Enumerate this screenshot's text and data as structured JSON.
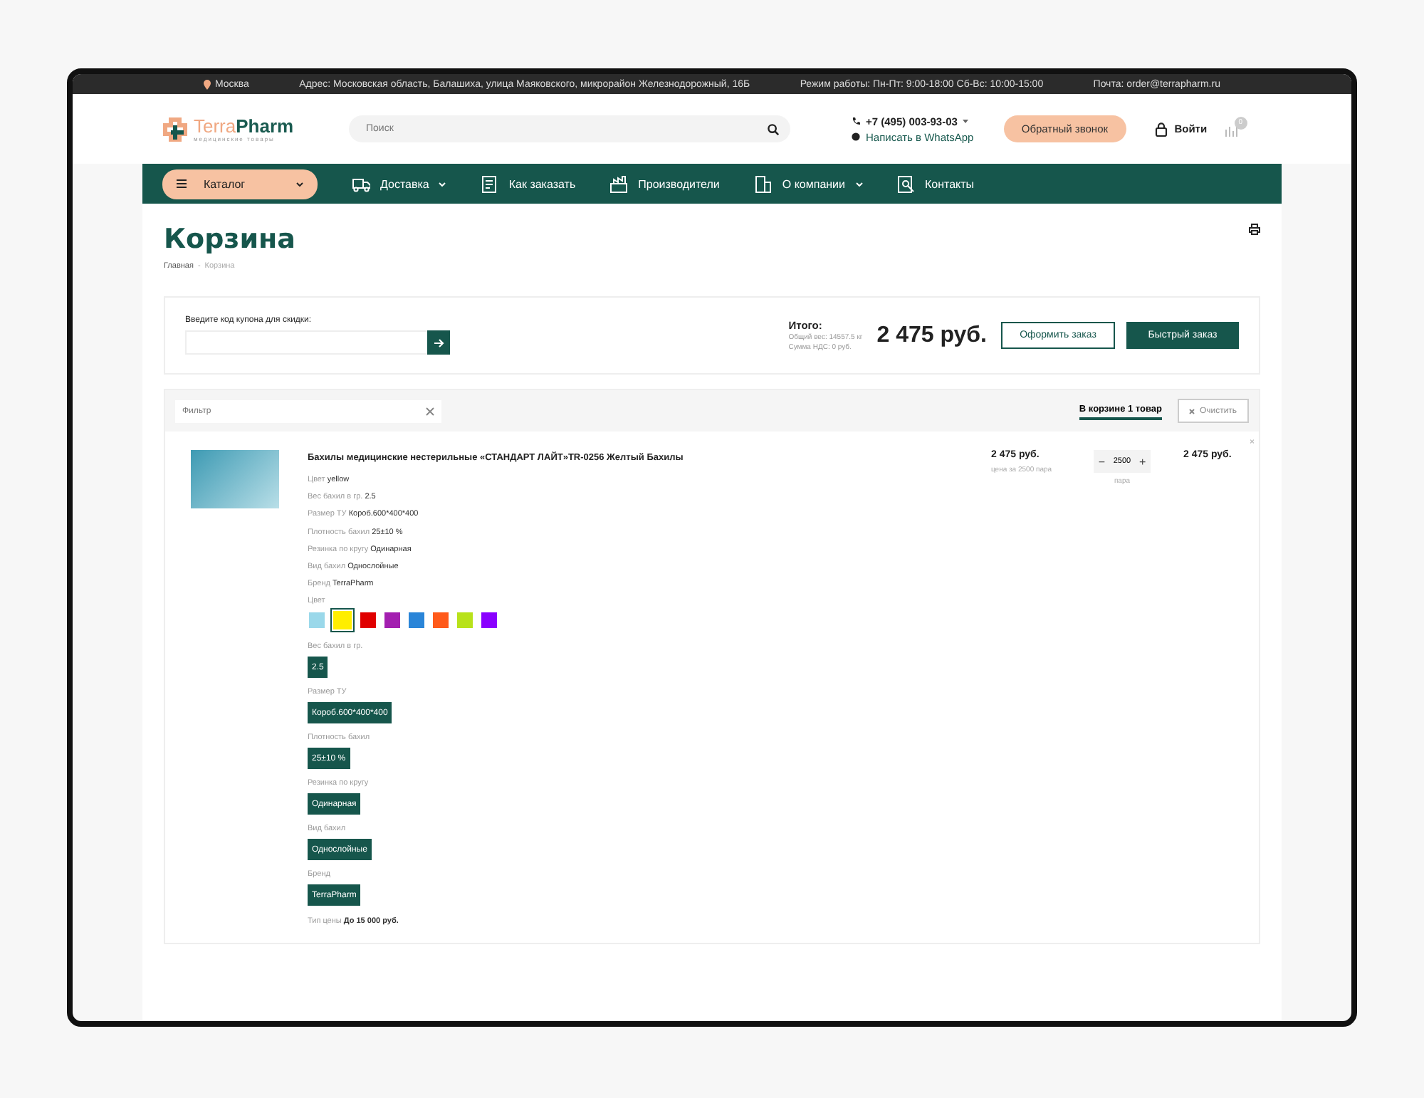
{
  "top_bar": {
    "city": "Москва",
    "address": "Адрес: Московская область, Балашиха, улица Маяковского, микрорайон Железнодорожный, 16Б",
    "hours": "Режим работы: Пн-Пт: 9:00-18:00 Сб-Вс: 10:00-15:00",
    "email": "Почта: order@terrapharm.ru"
  },
  "header": {
    "logo": {
      "part1": "Terra",
      "part2": "Pharm",
      "tagline": "медицинские товары"
    },
    "search": {
      "placeholder": "Поиск"
    },
    "phone": "+7 (495) 003-93-03",
    "whatsapp": "Написать в WhatsApp",
    "callback": "Обратный звонок",
    "login": "Войти",
    "cart_count": "0"
  },
  "nav": [
    {
      "label": "Каталог",
      "kind": "catalog",
      "has_caret": true
    },
    {
      "label": "Доставка",
      "kind": "link",
      "has_caret": true
    },
    {
      "label": "Как заказать",
      "kind": "link",
      "has_caret": false
    },
    {
      "label": "Производители",
      "kind": "link",
      "has_caret": false
    },
    {
      "label": "О компании",
      "kind": "link",
      "has_caret": true
    },
    {
      "label": "Контакты",
      "kind": "link",
      "has_caret": false
    }
  ],
  "page": {
    "title": "Корзина",
    "separator": "-",
    "breadcrumbs": [
      {
        "label": "Главная",
        "current": false
      },
      {
        "label": "Корзина",
        "current": true
      }
    ]
  },
  "coupon": {
    "label": "Введите код купона для скидки:"
  },
  "totals": {
    "label": "Итого:",
    "weight": "Общий вес: 14557.5 кг",
    "vat": "Сумма НДС: 0 руб.",
    "total": "2 475 руб.",
    "checkout": "Оформить заказ",
    "quick_order": "Быстрый заказ"
  },
  "cart": {
    "filter": {
      "placeholder": "Фильтр"
    },
    "tab": {
      "label": "В корзине 1 товар",
      "selected": true
    },
    "clear": "Очистить",
    "items": [
      {
        "title": "Бахилы медицинские нестерильные «СТАНДАРТ ЛАЙТ»TR-0256 Желтый Бахилы",
        "props": [
          {
            "name": "Цвет",
            "value": "yellow"
          },
          {
            "name": "Вес бахил в гр.",
            "value": "2.5"
          },
          {
            "name": "Размер ТУ",
            "value": "Короб.600*400*400"
          },
          {
            "name": "Плотность бахил",
            "value": "25±10 %"
          },
          {
            "name": "Резинка по кругу",
            "value": "Одинарная"
          },
          {
            "name": "Вид бахил",
            "value": "Однослойные"
          },
          {
            "name": "Бренд",
            "value": "TerraPharm"
          }
        ],
        "options": [
          {
            "label": "Цвет",
            "kind": "color",
            "choices": [
              {
                "color": "#9ad8ea",
                "selected": false
              },
              {
                "color": "#ffee00",
                "selected": true
              },
              {
                "color": "#e00000",
                "selected": false
              },
              {
                "color": "#a31fb0",
                "selected": false
              },
              {
                "color": "#2a85d8",
                "selected": false
              },
              {
                "color": "#ff5a1a",
                "selected": false
              },
              {
                "color": "#b8e21a",
                "selected": false
              },
              {
                "color": "#8a00ff",
                "selected": false
              }
            ]
          },
          {
            "label": "Вес бахил в гр.",
            "kind": "text",
            "choices": [
              {
                "label": "2.5",
                "selected": true
              }
            ]
          },
          {
            "label": "Размер ТУ",
            "kind": "text",
            "choices": [
              {
                "label": "Короб.600*400*400",
                "selected": true
              }
            ]
          },
          {
            "label": "Плотность бахил",
            "kind": "text",
            "choices": [
              {
                "label": "25±10 %",
                "selected": true
              }
            ]
          },
          {
            "label": "Резинка по кругу",
            "kind": "text",
            "choices": [
              {
                "label": "Одинарная",
                "selected": true
              }
            ]
          },
          {
            "label": "Вид бахил",
            "kind": "text",
            "choices": [
              {
                "label": "Однослойные",
                "selected": true
              }
            ]
          },
          {
            "label": "Бренд",
            "kind": "text",
            "choices": [
              {
                "label": "TerraPharm",
                "selected": true
              }
            ]
          }
        ],
        "price_type": {
          "name": "Тип цены",
          "value": "До 15 000 руб."
        },
        "price": "2 475 руб.",
        "price_note": "цена за 2500 пара",
        "decrement": "−",
        "quantity": "2500",
        "increment": "+",
        "unit": "пара",
        "remove": "×",
        "sum": "2 475 руб."
      }
    ]
  }
}
